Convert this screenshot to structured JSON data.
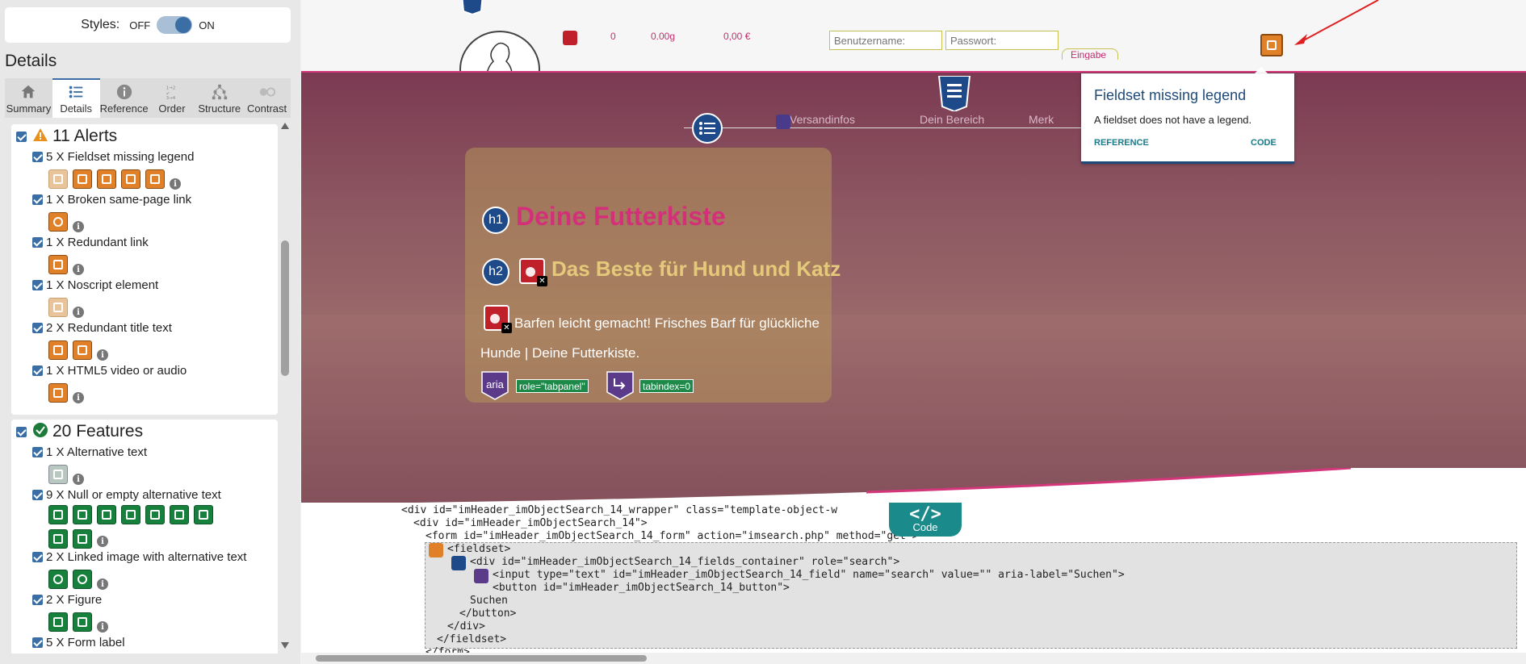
{
  "panel": {
    "styles_label": "Styles:",
    "toggle_off": "OFF",
    "toggle_on": "ON",
    "details_title": "Details",
    "tabs": [
      {
        "label": "Summary",
        "icon": "home-icon"
      },
      {
        "label": "Details",
        "icon": "list-icon"
      },
      {
        "label": "Reference",
        "icon": "info-icon"
      },
      {
        "label": "Order",
        "icon": "order-icon"
      },
      {
        "label": "Structure",
        "icon": "structure-icon"
      },
      {
        "label": "Contrast",
        "icon": "contrast-icon"
      }
    ],
    "alerts": {
      "title": "11 Alerts",
      "items": [
        {
          "label": "5 X Fieldset missing legend"
        },
        {
          "label": "1 X Broken same-page link"
        },
        {
          "label": "1 X Redundant link"
        },
        {
          "label": "1 X Noscript element"
        },
        {
          "label": "2 X Redundant title text"
        },
        {
          "label": "1 X HTML5 video or audio"
        }
      ]
    },
    "features": {
      "title": "20 Features",
      "items": [
        {
          "label": "1 X Alternative text"
        },
        {
          "label": "9 X Null or empty alternative text"
        },
        {
          "label": "2 X Linked image with alternative text"
        },
        {
          "label": "2 X Figure"
        },
        {
          "label": "5 X Form label"
        }
      ]
    }
  },
  "header": {
    "cart_count": "0",
    "cart_weight": "0.00g",
    "cart_price": "0,00 €",
    "username_placeholder": "Benutzername:",
    "password_placeholder": "Passwort:",
    "input_tab": "Eingabe"
  },
  "tooltip": {
    "title": "Fieldset missing legend",
    "description": "A fieldset does not have a legend.",
    "reference": "REFERENCE",
    "code": "CODE"
  },
  "nav": {
    "items": [
      "Versandinfos",
      "Dein Bereich",
      "Merk"
    ]
  },
  "hero": {
    "h1_badge": "h1",
    "h1": "Deine Futterkiste",
    "h2_badge": "h2",
    "h2": "Das Beste für Hund und Katz",
    "paragraph_line1": "Barfen leicht gemacht! Frisches Barf für glückliche",
    "paragraph_line2": "Hunde | Deine Futterkiste.",
    "aria_badge": "aria",
    "attr1": "role=\"tabpanel\"",
    "attr2": "tabindex=0"
  },
  "code_panel": {
    "tab_symbol": "</>",
    "tab_label": "Code",
    "lines": [
      "<div id=\"imHeader_imObjectSearch_14_wrapper\" class=\"template-object-w",
      "<div id=\"imHeader_imObjectSearch_14\">",
      "<form id=\"imHeader_imObjectSearch_14_form\" action=\"imsearch.php\" method=\"get\">",
      "<fieldset>",
      "<div id=\"imHeader_imObjectSearch_14_fields_container\" role=\"search\">",
      "<input type=\"text\" id=\"imHeader_imObjectSearch_14_field\" name=\"search\" value=\"\" aria-label=\"Suchen\">",
      "<button id=\"imHeader_imObjectSearch_14_button\">",
      "Suchen",
      "</button>",
      "</div>",
      "</fieldset>",
      "</form>"
    ]
  },
  "colors": {
    "accent": "#3a6ea5",
    "alert_orange": "#e0812a",
    "feature_green": "#16803c",
    "brand_pink": "#d4307a",
    "tooltip_blue": "#1e4a7a"
  }
}
